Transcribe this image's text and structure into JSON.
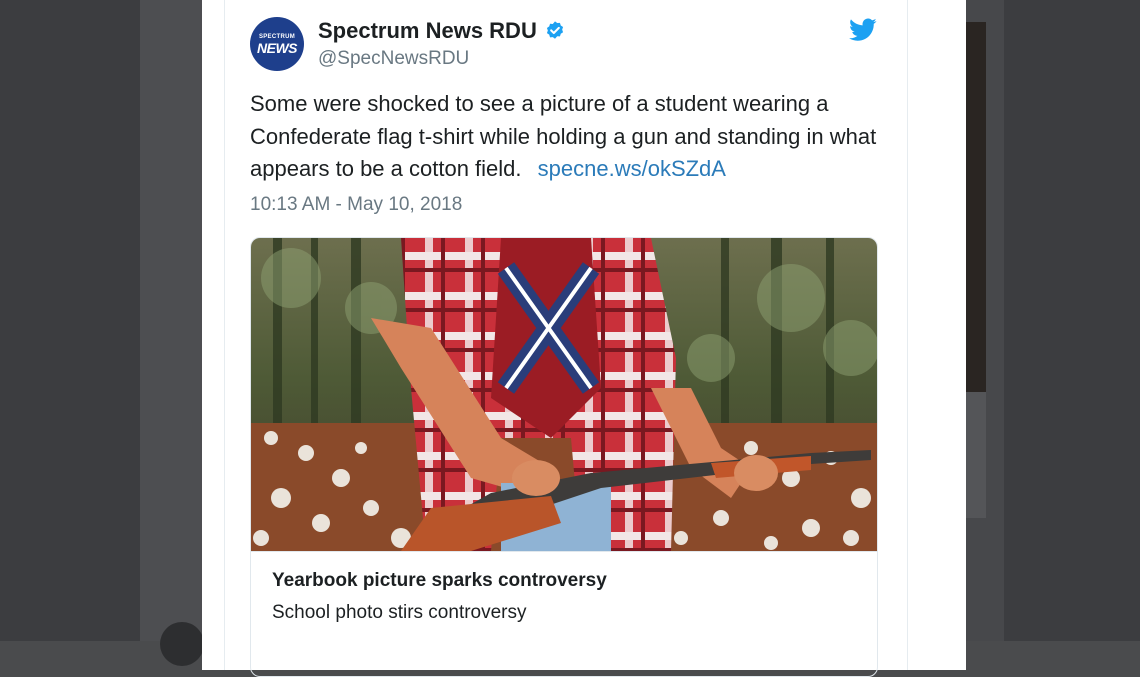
{
  "tweet": {
    "avatar": {
      "line1": "SPECTRUM",
      "line2": "NEWS",
      "bg_color": "#1e3f8c"
    },
    "display_name": "Spectrum News RDU",
    "verified_icon": "verified-badge-icon",
    "handle": "@SpecNewsRDU",
    "platform_icon": "twitter-bird-icon",
    "text": "Some were shocked to see a picture of a student wearing a Confederate flag t-shirt while holding a gun and standing in what appears to be a cotton field.",
    "link": "specne.ws/okSZdA",
    "timestamp": "10:13 AM - May 10, 2018",
    "card": {
      "title": "Yearbook picture sparks controversy",
      "description": "School photo stirs controversy"
    }
  },
  "colors": {
    "link": "#2b7bb9",
    "twitter_blue": "#1da1f2",
    "secondary_text": "#697882",
    "primary_text": "#1c2022"
  }
}
